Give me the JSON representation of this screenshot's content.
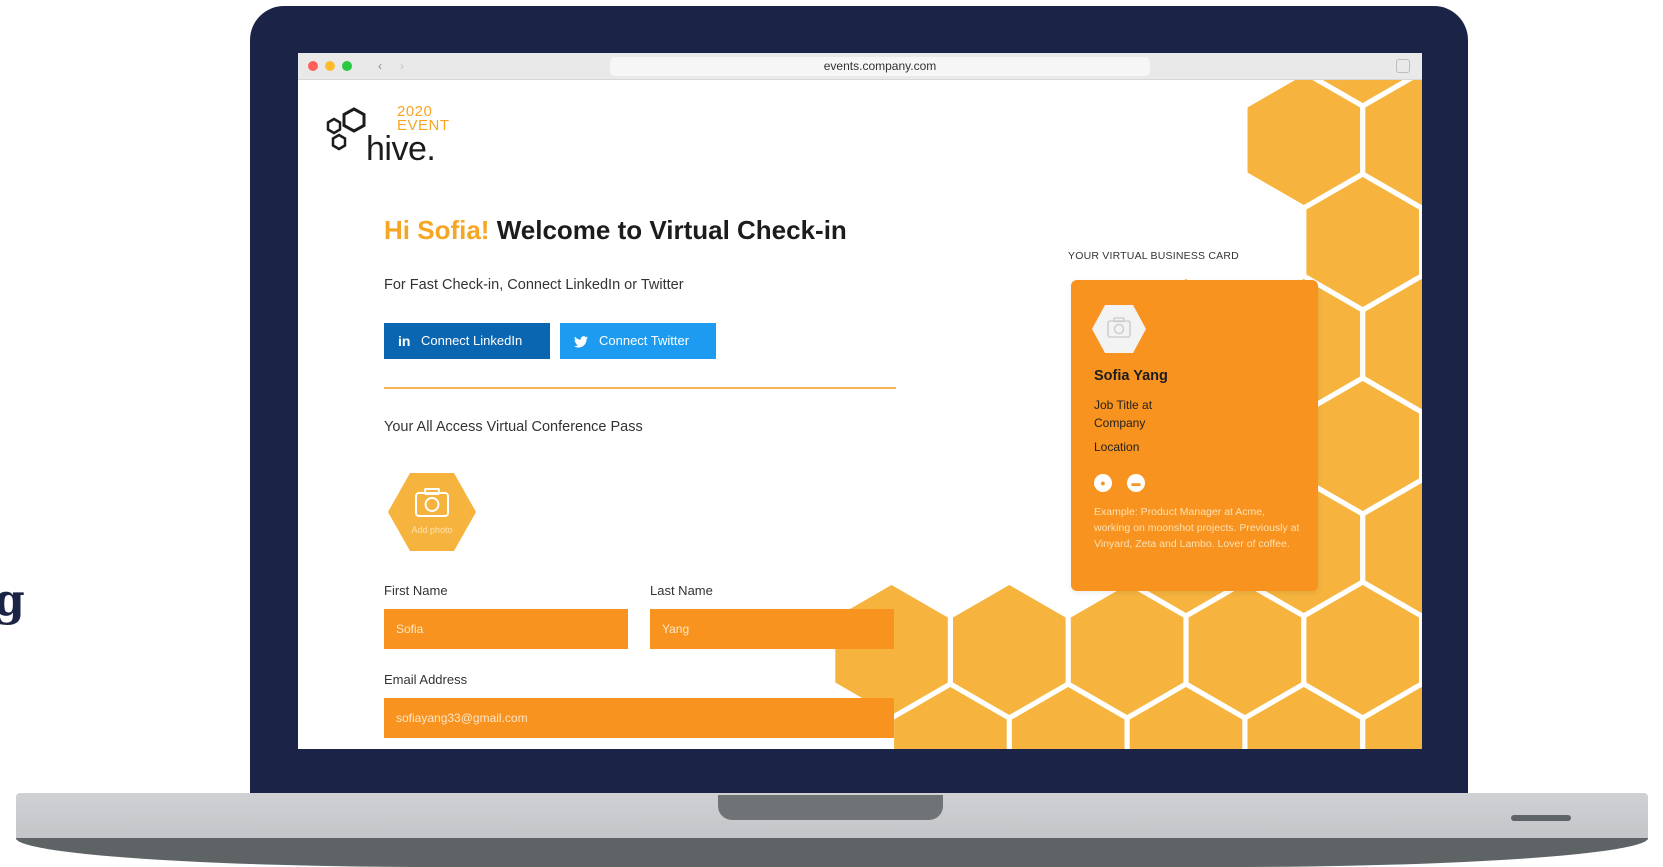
{
  "stray_text": "g",
  "browser": {
    "url": "events.company.com",
    "back_icon": "chevron-left-icon",
    "forward_icon": "chevron-right-icon"
  },
  "logo": {
    "year": "2020",
    "event": "EVENT",
    "word": "hive."
  },
  "greeting": {
    "hi": "Hi Sofia!",
    "rest": "Welcome to Virtual Check-in"
  },
  "subtitle": "For Fast Check-in, Connect LinkedIn or Twitter",
  "buttons": {
    "linkedin": {
      "icon_text": "in",
      "label": "Connect LinkedIn"
    },
    "twitter": {
      "icon": "twitter-bird-icon",
      "label": "Connect Twitter"
    }
  },
  "pass_title": "Your All Access Virtual Conference Pass",
  "photo": {
    "label": "Add photo",
    "icon": "camera-icon"
  },
  "form": {
    "first_name": {
      "label": "First Name",
      "value": "Sofia"
    },
    "last_name": {
      "label": "Last Name",
      "value": "Yang"
    },
    "email": {
      "label": "Email Address",
      "value": "sofiayang33@gmail.com"
    }
  },
  "card": {
    "heading": "YOUR VIRTUAL BUSINESS CARD",
    "name": "Sofia Yang",
    "job": "Job Title at Company",
    "location": "Location",
    "bio": "Example: Product Manager at Acme, working on moonshot projects. Previously at Vinyard, Zeta and Lambo. Lover of coffee."
  },
  "colors": {
    "accent_orange": "#f7931e",
    "honey_yellow": "#f6b43e",
    "linkedin_blue": "#0b66b2",
    "twitter_blue": "#1d9bf0",
    "laptop_navy": "#1b2446"
  }
}
